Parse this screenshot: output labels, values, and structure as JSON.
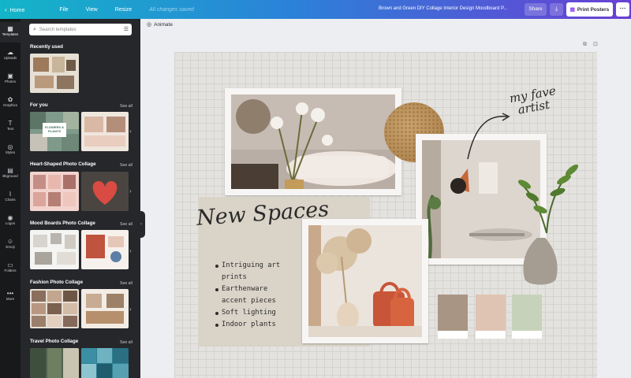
{
  "topbar": {
    "home": "Home",
    "file": "File",
    "view": "View",
    "resize": "Resize",
    "saved": "All changes saved",
    "document_title": "Brown and Green DIY Collage Interior Design Moodboard P...",
    "share": "Share",
    "print": "Print Posters",
    "colors": {
      "gradient_start": "#14b5c8",
      "gradient_mid": "#2a83d8",
      "gradient_end": "#6a3fd4"
    }
  },
  "rail": [
    {
      "label": "Templates",
      "icon": "templates-icon",
      "glyph": "▦"
    },
    {
      "label": "Uploads",
      "icon": "cloud-upload-icon",
      "glyph": "☁"
    },
    {
      "label": "Photos",
      "icon": "photos-icon",
      "glyph": "▣"
    },
    {
      "label": "Graphics",
      "icon": "graphics-icon",
      "glyph": "✿"
    },
    {
      "label": "Text",
      "icon": "text-icon",
      "glyph": "T"
    },
    {
      "label": "Styles",
      "icon": "styles-icon",
      "glyph": "◎"
    },
    {
      "label": "Bkground",
      "icon": "background-icon",
      "glyph": "▤"
    },
    {
      "label": "Charts",
      "icon": "charts-icon",
      "glyph": "⌇"
    },
    {
      "label": "Logos",
      "icon": "logos-icon",
      "glyph": "◉"
    },
    {
      "label": "Emoji",
      "icon": "emoji-icon",
      "glyph": "☺"
    },
    {
      "label": "Folders",
      "icon": "folders-icon",
      "glyph": "▭"
    },
    {
      "label": "More",
      "icon": "more-icon",
      "glyph": "•••"
    }
  ],
  "panel": {
    "search_placeholder": "Search templates",
    "see_all": "See all",
    "sections": [
      {
        "title": "Recently used"
      },
      {
        "title": "For you"
      },
      {
        "title": "Heart-Shaped Photo Collage"
      },
      {
        "title": "Mood Boards Photo Collage"
      },
      {
        "title": "Fashion Photo Collage"
      },
      {
        "title": "Travel Photo Collage"
      }
    ],
    "thumb_label": "FLOWERS & PLANTS"
  },
  "canvas": {
    "animate": "Animate",
    "heading": "New Spaces",
    "bullets": [
      "Intriguing art",
      "prints",
      "Earthenware",
      "accent pieces",
      "Soft lighting",
      "Indoor plants"
    ],
    "script_note_lines": [
      "my fave",
      "artist"
    ],
    "swatches": [
      "#a89584",
      "#e0c4b3",
      "#c6d3ba"
    ]
  }
}
